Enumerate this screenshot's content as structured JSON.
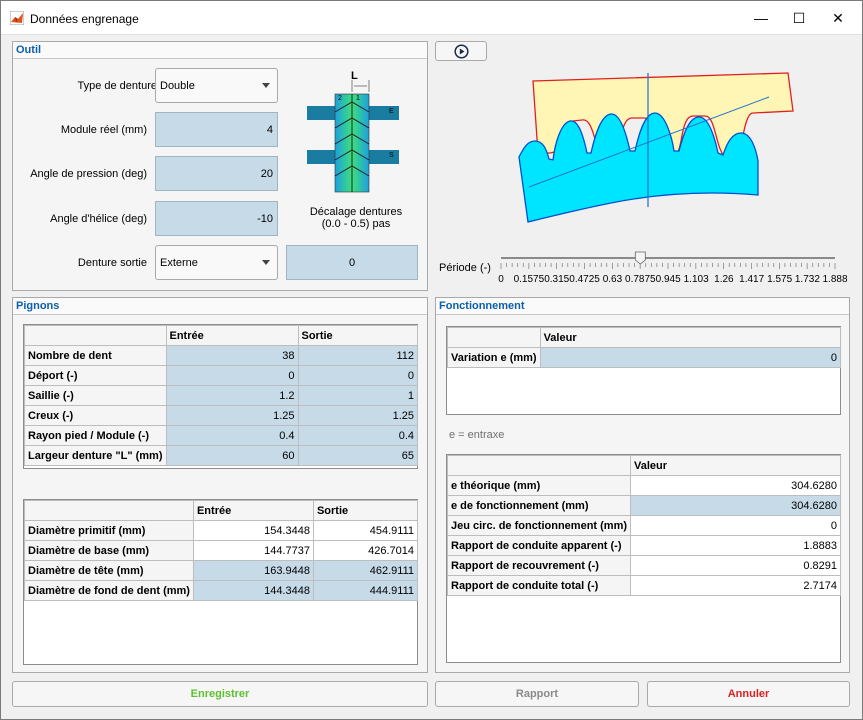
{
  "window": {
    "title": "Données engrenage",
    "minimize": "—",
    "maximize": "☐",
    "close": "✕"
  },
  "outil": {
    "title": "Outil",
    "type_denture": {
      "label": "Type de denture",
      "value": "Double"
    },
    "module_reel": {
      "label": "Module réel (mm)",
      "value": "4"
    },
    "angle_pression": {
      "label": "Angle de pression (deg)",
      "value": "20"
    },
    "angle_helice": {
      "label": "Angle d'hélice (deg)",
      "value": "-10"
    },
    "denture_sortie": {
      "label": "Denture sortie",
      "value": "Externe"
    },
    "decalage": {
      "label_line1": "Décalage dentures",
      "label_line2": "(0.0 - 0.5) pas",
      "value": "0"
    },
    "diagram": {
      "L": "L",
      "n2": "2",
      "n1": "1",
      "E": "E",
      "S": "S"
    }
  },
  "periode": {
    "label": "Période (-)",
    "ticks": [
      "0",
      "0.1575",
      "0.315",
      "0.4725",
      "0.63",
      "0.7875",
      "0.945",
      "1.103",
      "1.26",
      "1.417",
      "1.575",
      "1.732",
      "1.888"
    ],
    "value": 0.7875
  },
  "pignons": {
    "title": "Pignons",
    "table1": {
      "headers": [
        "",
        "Entrée",
        "Sortie"
      ],
      "rows": [
        {
          "label": "Nombre de dent",
          "entree": "38",
          "sortie": "112"
        },
        {
          "label": "Déport (-)",
          "entree": "0",
          "sortie": "0"
        },
        {
          "label": "Saillie (-)",
          "entree": "1.2",
          "sortie": "1"
        },
        {
          "label": "Creux (-)",
          "entree": "1.25",
          "sortie": "1.25"
        },
        {
          "label": "Rayon pied / Module (-)",
          "entree": "0.4",
          "sortie": "0.4"
        },
        {
          "label": "Largeur denture \"L\" (mm)",
          "entree": "60",
          "sortie": "65"
        }
      ]
    },
    "table2": {
      "headers": [
        "",
        "Entrée",
        "Sortie"
      ],
      "rows": [
        {
          "label": "Diamètre primitif (mm)",
          "entree": "154.3448",
          "sortie": "454.9111"
        },
        {
          "label": "Diamètre de base (mm)",
          "entree": "144.7737",
          "sortie": "426.7014"
        },
        {
          "label": "Diamètre de tête (mm)",
          "entree": "163.9448",
          "sortie": "462.9111"
        },
        {
          "label": "Diamètre de fond de dent (mm)",
          "entree": "144.3448",
          "sortie": "444.9111"
        }
      ]
    }
  },
  "fonctionnement": {
    "title": "Fonctionnement",
    "table1": {
      "header": "Valeur",
      "rows": [
        {
          "label": "Variation e (mm)",
          "value": "0"
        }
      ]
    },
    "note": "e = entraxe",
    "table2": {
      "header": "Valeur",
      "rows": [
        {
          "label": "e théorique (mm)",
          "value": "304.6280"
        },
        {
          "label": "e de fonctionnement (mm)",
          "value": "304.6280"
        },
        {
          "label": "Jeu circ. de fonctionnement (mm)",
          "value": "0"
        },
        {
          "label": "Rapport de conduite apparent (-)",
          "value": "1.8883"
        },
        {
          "label": "Rapport de recouvrement (-)",
          "value": "0.8291"
        },
        {
          "label": "Rapport de conduite total (-)",
          "value": "2.7174"
        }
      ]
    }
  },
  "buttons": {
    "enregistrer": "Enregistrer",
    "rapport": "Rapport",
    "annuler": "Annuler"
  },
  "colors": {
    "accent": "#0b5fad",
    "field": "#c6dae8",
    "gear_upper": "#fff5b5",
    "gear_lower": "#00e5ff",
    "enregistrer": "#5ec030",
    "annuler": "#e02020",
    "rapport": "#8a8a8a"
  }
}
